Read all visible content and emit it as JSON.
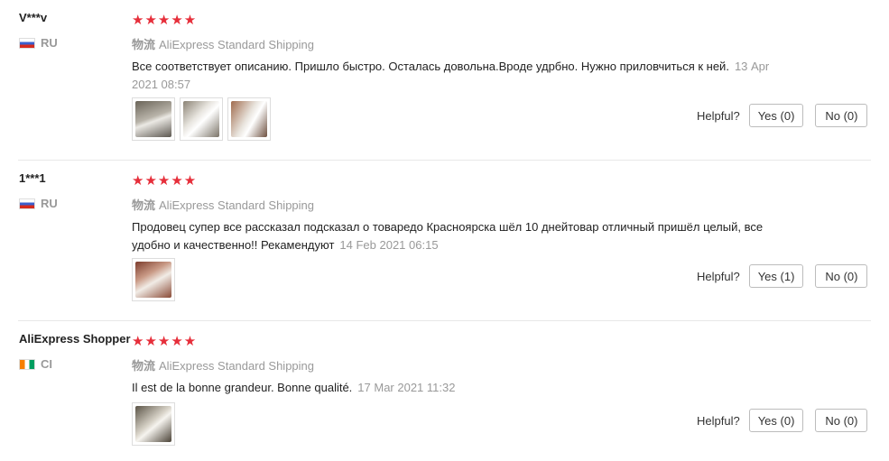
{
  "reviews": [
    {
      "user": "V***v",
      "country": "RU",
      "stars": "★★★★★",
      "shipping_label": "物流",
      "shipping": "AliExpress Standard Shipping",
      "text": "Все соответствует описанию. Пришло быстро. Осталась довольна.Вроде удрбно. Нужно приловчиться к ней.",
      "date": "13 Apr 2021 08:57",
      "helpful_label": "Helpful?",
      "yes_label": "Yes (0)",
      "no_label": "No (0)"
    },
    {
      "user": "1***1",
      "country": "RU",
      "stars": "★★★★★",
      "shipping_label": "物流",
      "shipping": "AliExpress Standard Shipping",
      "text": "Продовец супер все рассказал подсказал о товаредо Красноярска шёл 10 днейтовар отличный пришёл целый, все удобно и качественно!! Рекамендуют",
      "date": "14 Feb 2021 06:15",
      "helpful_label": "Helpful?",
      "yes_label": "Yes (1)",
      "no_label": "No (0)"
    },
    {
      "user": "AliExpress Shopper",
      "country": "CI",
      "stars": "★★★★★",
      "shipping_label": "物流",
      "shipping": "AliExpress Standard Shipping",
      "text": "Il est de la bonne grandeur. Bonne qualité.",
      "date": "17 Mar 2021 11:32",
      "helpful_label": "Helpful?",
      "yes_label": "Yes (0)",
      "no_label": "No (0)"
    }
  ],
  "colors": {
    "star": "#e62e3a",
    "muted": "#999999",
    "border": "#bcbcbc"
  }
}
